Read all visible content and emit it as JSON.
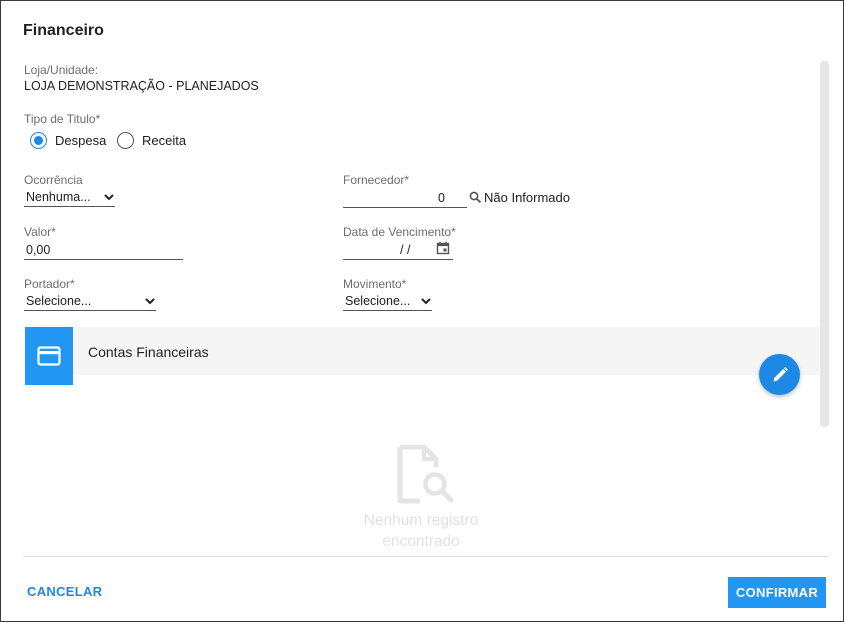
{
  "dialog": {
    "title": "Financeiro"
  },
  "loja": {
    "label": "Loja/Unidade:",
    "value": "LOJA DEMONSTRAÇÃO - PLANEJADOS"
  },
  "tipo_titulo": {
    "label": "Tipo de Titulo*",
    "options": [
      {
        "label": "Despesa",
        "selected": true
      },
      {
        "label": "Receita",
        "selected": false
      }
    ]
  },
  "ocorrencia": {
    "label": "Ocorrência",
    "value": "Nenhuma..."
  },
  "fornecedor": {
    "label": "Fornecedor*",
    "value": "0",
    "name": "Não Informado"
  },
  "valor": {
    "label": "Valor*",
    "value": "0,00"
  },
  "vencimento": {
    "label": "Data de Vencimento*",
    "value": "/ /"
  },
  "portador": {
    "label": "Portador*",
    "value": "Selecione..."
  },
  "movimento": {
    "label": "Movimento*",
    "value": "Selecione..."
  },
  "contas": {
    "title": "Contas Financeiras",
    "empty_text": "Nenhum registro encontrado"
  },
  "footer": {
    "cancel": "CANCELAR",
    "confirm": "CONFIRMAR"
  },
  "colors": {
    "accent": "#2196f3",
    "accent_dark": "#1e88e5"
  },
  "icons": {
    "section": "credit-card-icon",
    "fab": "pencil-icon",
    "search": "search-icon",
    "calendar": "calendar-icon",
    "empty": "document-search-icon"
  }
}
